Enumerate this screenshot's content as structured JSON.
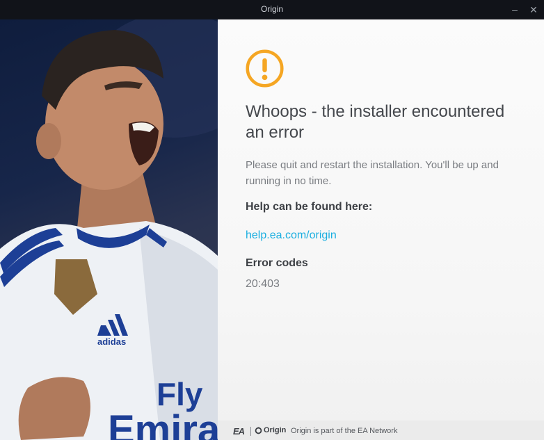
{
  "window": {
    "title": "Origin",
    "minimize_glyph": "–",
    "close_glyph": "✕"
  },
  "hero": {
    "jersey_text_line1": "Fly",
    "jersey_text_line2": "Emirat"
  },
  "error": {
    "icon": "warning-circle-icon",
    "accent_color": "#f5a623",
    "heading": "Whoops - the installer encountered an error",
    "message": "Please quit and restart the installation. You'll be up and running in no time.",
    "help_heading": "Help can be found here:",
    "help_link": "help.ea.com/origin",
    "codes_heading": "Error codes",
    "codes_value": "20:403"
  },
  "footer": {
    "ea_logo": "EA",
    "origin_logo": "Origin",
    "text": "Origin is part of the EA Network"
  },
  "colors": {
    "link": "#1aaee0",
    "titlebar": "#111319"
  }
}
